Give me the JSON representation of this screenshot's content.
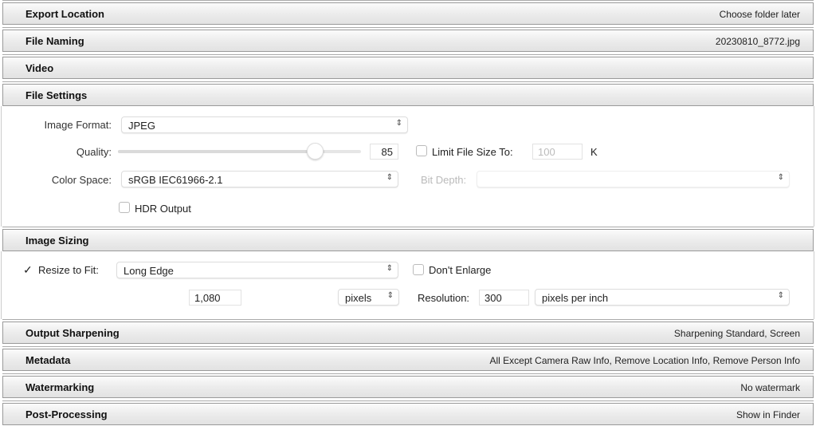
{
  "sections": [
    {
      "title": "Export Location",
      "summary": "Choose folder later"
    },
    {
      "title": "File Naming",
      "summary": "20230810_8772.jpg"
    },
    {
      "title": "Video",
      "summary": ""
    },
    {
      "title": "File Settings",
      "summary": ""
    },
    {
      "title": "Image Sizing",
      "summary": ""
    },
    {
      "title": "Output Sharpening",
      "summary": "Sharpening Standard, Screen"
    },
    {
      "title": "Metadata",
      "summary": "All Except Camera Raw Info, Remove Location Info, Remove Person Info"
    },
    {
      "title": "Watermarking",
      "summary": "No watermark"
    },
    {
      "title": "Post-Processing",
      "summary": "Show in Finder"
    }
  ],
  "file_settings": {
    "image_format_label": "Image Format:",
    "image_format": "JPEG",
    "quality_label": "Quality:",
    "quality": "85",
    "quality_percent": 85,
    "limit_label": "Limit File Size To:",
    "limit_value": "100",
    "limit_unit": "K",
    "limit_checked": false,
    "color_space_label": "Color Space:",
    "color_space": "sRGB IEC61966-2.1",
    "bit_depth_label": "Bit Depth:",
    "bit_depth": "",
    "hdr_label": "HDR Output",
    "hdr_checked": false
  },
  "image_sizing": {
    "resize_label": "Resize to Fit:",
    "resize_checked": true,
    "resize_mode": "Long Edge",
    "dont_enlarge_label": "Don't Enlarge",
    "dont_enlarge_checked": false,
    "size_value": "1,080",
    "size_unit": "pixels",
    "resolution_label": "Resolution:",
    "resolution": "300",
    "resolution_unit": "pixels per inch"
  },
  "icons": {
    "select_arrow": "⌃⌄",
    "check": "✓"
  }
}
